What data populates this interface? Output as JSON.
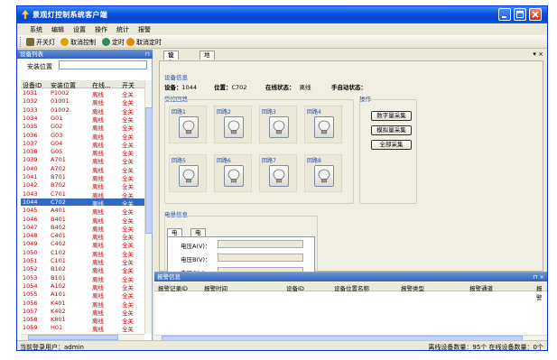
{
  "window": {
    "title": "景观灯控制系统客户端",
    "controls": [
      "minimize-icon",
      "maximize-icon",
      "close-icon"
    ]
  },
  "menu": [
    "系统",
    "编辑",
    "设置",
    "操作",
    "统计",
    "报警"
  ],
  "toolbar": [
    {
      "label": "开关灯",
      "icon": "light-switch-icon",
      "color": "#7d6a3a"
    },
    {
      "label": "取消控制",
      "icon": "cancel-control-icon",
      "color": "#d9a300"
    },
    {
      "label": "定时",
      "icon": "clock-icon",
      "color": "#2e8b57"
    },
    {
      "label": "取消定时",
      "icon": "cancel-timer-icon",
      "color": "#e08a00"
    }
  ],
  "device_list": {
    "title": "设备列表",
    "location_label": "安装位置",
    "location_value": "",
    "columns": [
      "设备ID",
      "安装位置",
      "在线...",
      "开关"
    ],
    "rows": [
      [
        "1031",
        "P1002",
        "离线",
        "全关"
      ],
      [
        "1032",
        "01001",
        "离线",
        "全关"
      ],
      [
        "1033",
        "01002",
        "离线",
        "全关"
      ],
      [
        "1034",
        "G01",
        "离线",
        "全关"
      ],
      [
        "1035",
        "G02",
        "离线",
        "全关"
      ],
      [
        "1036",
        "G03",
        "离线",
        "全关"
      ],
      [
        "1037",
        "G04",
        "离线",
        "全关"
      ],
      [
        "1038",
        "G05",
        "离线",
        "全关"
      ],
      [
        "1039",
        "A701",
        "离线",
        "全关"
      ],
      [
        "1040",
        "A702",
        "离线",
        "全关"
      ],
      [
        "1041",
        "B701",
        "离线",
        "全关"
      ],
      [
        "1042",
        "B702",
        "离线",
        "全关"
      ],
      [
        "1043",
        "C701",
        "离线",
        "全关"
      ],
      [
        "1044",
        "C702",
        "离线",
        "全关"
      ],
      [
        "1045",
        "A401",
        "离线",
        "全关"
      ],
      [
        "1046",
        "B401",
        "离线",
        "全关"
      ],
      [
        "1047",
        "B402",
        "离线",
        "全关"
      ],
      [
        "1048",
        "C401",
        "离线",
        "全关"
      ],
      [
        "1049",
        "C402",
        "离线",
        "全关"
      ],
      [
        "1050",
        "C102",
        "离线",
        "全关"
      ],
      [
        "1051",
        "C101",
        "离线",
        "全关"
      ],
      [
        "1052",
        "B102",
        "离线",
        "全关"
      ],
      [
        "1053",
        "B101",
        "离线",
        "全关"
      ],
      [
        "1054",
        "A102",
        "离线",
        "全关"
      ],
      [
        "1055",
        "A101",
        "离线",
        "全关"
      ],
      [
        "1056",
        "K401",
        "离线",
        "全关"
      ],
      [
        "1057",
        "K402",
        "离线",
        "全关"
      ],
      [
        "1058",
        "K801",
        "离线",
        "全关"
      ],
      [
        "1059",
        "H01",
        "离线",
        "全关"
      ],
      [
        "1060",
        "G06",
        "离线",
        "全关"
      ]
    ],
    "selected_id": "1044"
  },
  "tabs": [
    "设备信息",
    "地图"
  ],
  "right_tools": "▾ ×",
  "device_info": {
    "caption": "设备信息",
    "device_label": "设备：",
    "device_value": "1044",
    "location_label": "位置：",
    "location_value": "C702",
    "online_label": "在线状态：",
    "online_value": "离线",
    "manual_label": "手自动状态：",
    "manual_value": ""
  },
  "circuits": {
    "caption": "受控回路",
    "items": [
      "回路1",
      "回路2",
      "回路3",
      "回路4",
      "回路5",
      "回路6",
      "回路7",
      "回路8"
    ]
  },
  "operations": {
    "caption": "操作",
    "buttons": [
      "数字量采集",
      "模拟量采集",
      "全部采集"
    ]
  },
  "power": {
    "caption": "电量信息",
    "tabs": [
      "电压",
      "电流"
    ],
    "fields": [
      {
        "label": "电压A(V)：",
        "value": ""
      },
      {
        "label": "电压B(V)：",
        "value": ""
      },
      {
        "label": "电压C(V)：",
        "value": ""
      }
    ]
  },
  "alarm": {
    "title": "报警信息",
    "columns": [
      "报警记录ID",
      "报警时间",
      "设备ID",
      "设备位置名称",
      "报警类型",
      "报警通道",
      "报警"
    ]
  },
  "status": {
    "left": "当前登录用户：admin",
    "right": "离线设备数量：95个 在线设备数量：0个"
  },
  "colors": {
    "titlebar": "#0a4fd8",
    "offline_text": "#c00000",
    "selected_row": "#316ac5",
    "group_caption": "#1c4bb7"
  }
}
